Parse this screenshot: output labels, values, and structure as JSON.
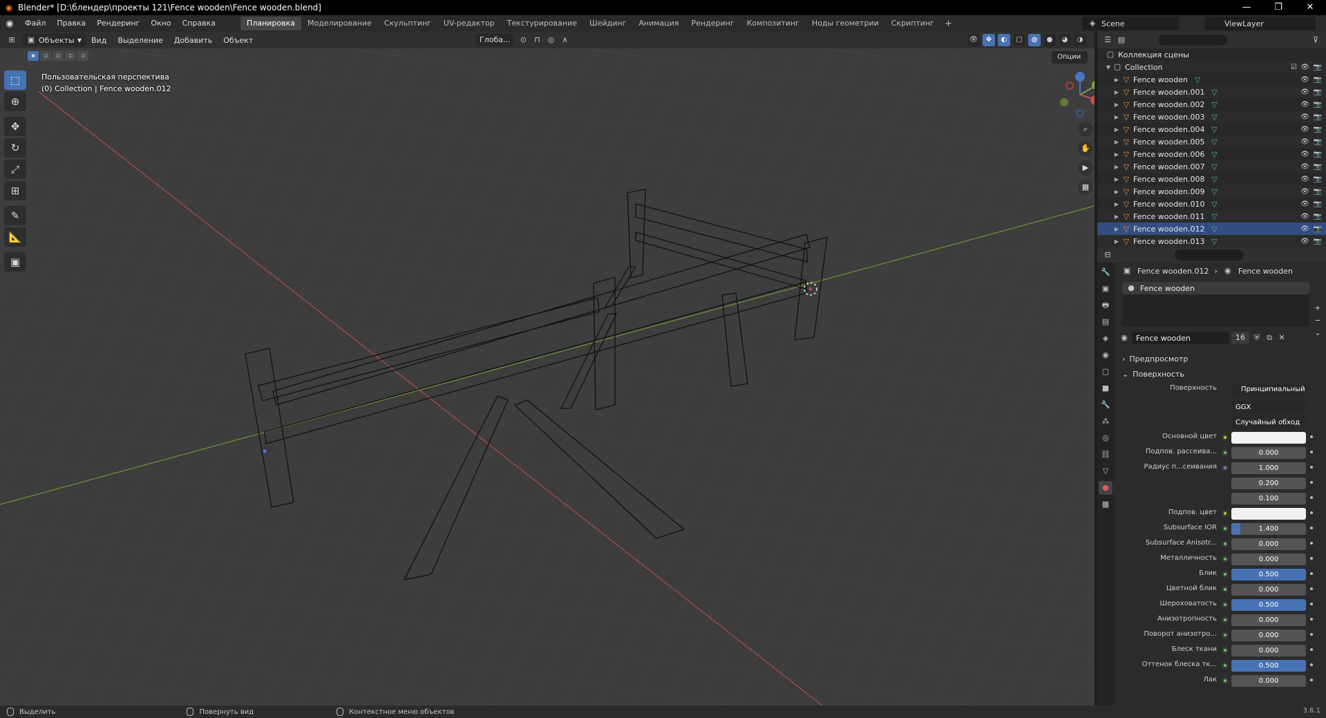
{
  "window": {
    "title": "Blender* [D:\\блендер\\проекты 121\\Fence wooden\\Fence wooden.blend]",
    "minimize": "—",
    "maximize": "❐",
    "close": "✕"
  },
  "topbar": {
    "menus": [
      "Файл",
      "Правка",
      "Рендеринг",
      "Окно",
      "Справка"
    ],
    "workspaces": [
      "Планировка",
      "Моделирование",
      "Скульптинг",
      "UV-редактор",
      "Текстурирование",
      "Шейдинг",
      "Анимация",
      "Рендеринг",
      "Композитинг",
      "Ноды геометрии",
      "Скриптинг"
    ],
    "active_workspace": "Планировка",
    "add": "+",
    "scene": "Scene",
    "view_layer": "ViewLayer"
  },
  "viewport": {
    "mode": "Объекты",
    "menus": [
      "Вид",
      "Выделение",
      "Добавить",
      "Объект"
    ],
    "transform_orientation": "Глоба...",
    "options": "Опции",
    "info_line1": "Пользовательская перспектива",
    "info_line2": "(0) Collection | Fence wooden.012"
  },
  "outliner": {
    "scene_collection": "Коллекция сцены",
    "collection": "Collection",
    "items": [
      {
        "name": "Fence wooden"
      },
      {
        "name": "Fence wooden.001"
      },
      {
        "name": "Fence wooden.002"
      },
      {
        "name": "Fence wooden.003"
      },
      {
        "name": "Fence wooden.004"
      },
      {
        "name": "Fence wooden.005"
      },
      {
        "name": "Fence wooden.006"
      },
      {
        "name": "Fence wooden.007"
      },
      {
        "name": "Fence wooden.008"
      },
      {
        "name": "Fence wooden.009"
      },
      {
        "name": "Fence wooden.010"
      },
      {
        "name": "Fence wooden.011"
      },
      {
        "name": "Fence wooden.012"
      },
      {
        "name": "Fence wooden.013"
      }
    ],
    "selected_index": 12
  },
  "properties": {
    "breadcrumb_object": "Fence wooden.012",
    "breadcrumb_material": "Fence wooden",
    "slot": "Fence wooden",
    "material_name": "Fence wooden",
    "users": "16",
    "panel_preview": "Предпросмотр",
    "panel_surface": "Поверхность",
    "surface_label": "Поверхность",
    "surface_value": "Принципиальный BSDF",
    "distribution": "GGX",
    "subsurface_method": "Случайный обход",
    "rows": [
      {
        "label": "Основной цвет",
        "type": "color",
        "dot": "yellow"
      },
      {
        "label": "Подпов. рассеива...",
        "value": "0.000",
        "fill": 0,
        "dot": "green"
      },
      {
        "label": "Радиус п...сеивания",
        "value": "1.000",
        "fill": 0,
        "dot": "blue"
      },
      {
        "label": "",
        "value": "0.200",
        "fill": 0,
        "dot": "none"
      },
      {
        "label": "",
        "value": "0.100",
        "fill": 0,
        "dot": "none"
      },
      {
        "label": "Подпов. цвет",
        "type": "color",
        "dot": "yellow"
      },
      {
        "label": "Subsurface IOR",
        "value": "1.400",
        "fill": 0.12,
        "dot": "green"
      },
      {
        "label": "Subsurface Anisotr...",
        "value": "0.000",
        "fill": 0,
        "dot": "green"
      },
      {
        "label": "Металличность",
        "value": "0.000",
        "fill": 0,
        "dot": "green"
      },
      {
        "label": "Блик",
        "value": "0.500",
        "fill": 1,
        "dot": "green"
      },
      {
        "label": "Цветной блик",
        "value": "0.000",
        "fill": 0,
        "dot": "green"
      },
      {
        "label": "Шероховатость",
        "value": "0.500",
        "fill": 1,
        "dot": "green"
      },
      {
        "label": "Анизотропность",
        "value": "0.000",
        "fill": 0,
        "dot": "green"
      },
      {
        "label": "Поворот анизотро...",
        "value": "0.000",
        "fill": 0,
        "dot": "green"
      },
      {
        "label": "Блеск ткани",
        "value": "0.000",
        "fill": 0,
        "dot": "green"
      },
      {
        "label": "Оттенок блеска тк...",
        "value": "0.500",
        "fill": 1,
        "dot": "green"
      },
      {
        "label": "Лак",
        "value": "0.000",
        "fill": 0,
        "dot": "green"
      }
    ]
  },
  "statusbar": {
    "select": "Выделить",
    "rotate": "Повернуть вид",
    "context": "Контекстное меню объектов",
    "version": "3.6.1"
  },
  "colors": {
    "accent": "#4772b3",
    "x_axis": "#c84c4c",
    "y_axis": "#7aa33a",
    "object_orange": "#e8913a"
  }
}
